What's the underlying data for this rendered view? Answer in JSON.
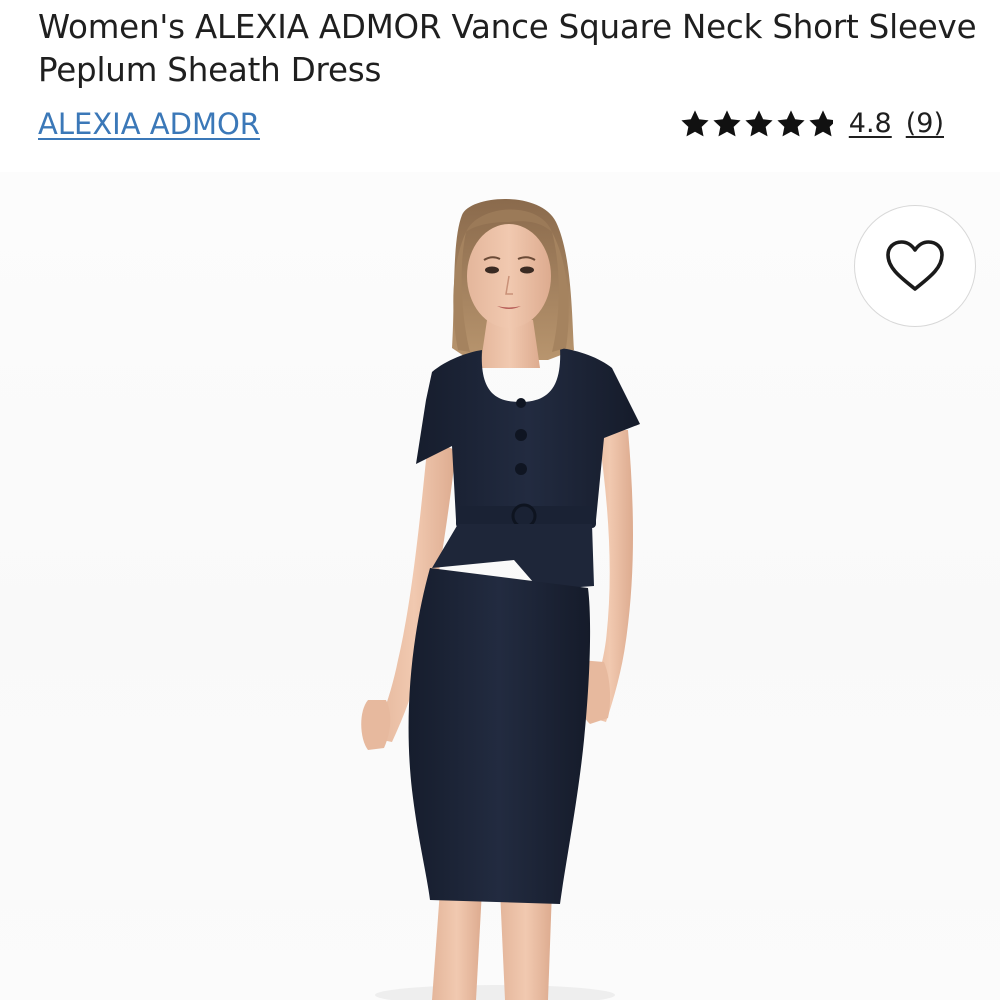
{
  "product": {
    "title": "Women's ALEXIA ADMOR Vance Square Neck Short Sleeve Peplum Sheath Dress",
    "brand": "ALEXIA ADMOR",
    "rating_value": "4.8",
    "review_count": "(9)",
    "rating_stars": 4.8,
    "image_icon": "model-wearing-navy-dress-photo"
  },
  "colors": {
    "brand_link": "#3b78b8",
    "text": "#1f1f1f",
    "dress": "#1c2437",
    "wishlist_border": "#d8d8d8"
  },
  "icons": {
    "star": "star-icon",
    "heart": "heart-outline-icon"
  }
}
